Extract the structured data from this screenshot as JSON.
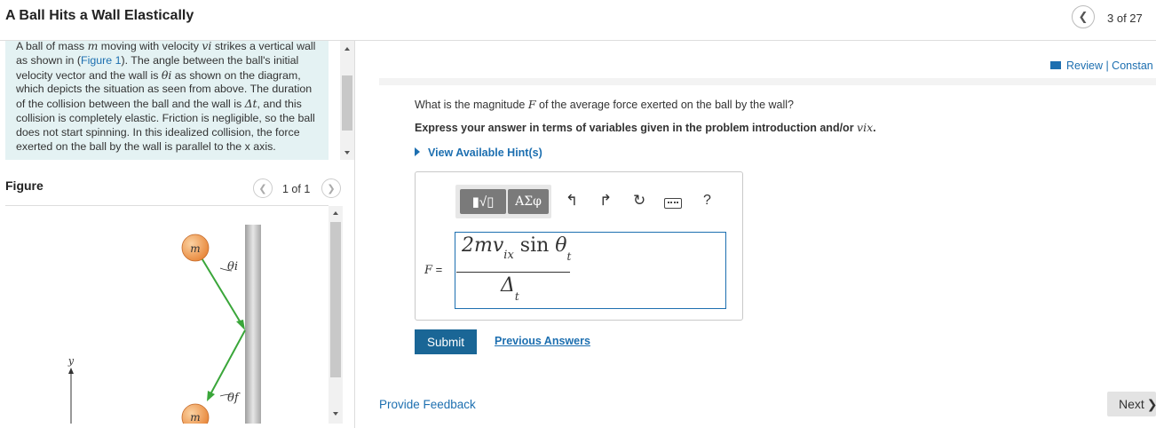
{
  "header": {
    "title": "A Ball Hits a Wall Elastically",
    "prev_icon": "chevron-left-icon",
    "counter": "3 of 27"
  },
  "intro": {
    "t1": "A ball of mass ",
    "v_m": "m",
    "t2": " moving with velocity ",
    "v_vi": "vi",
    "t3": " strikes a vertical wall as shown in (",
    "figure_link": "Figure 1",
    "t4": "). The angle between the ball's initial velocity vector and the wall is ",
    "v_thetai": "θi",
    "t5": " as shown on the diagram, which depicts the situation as seen from above. The duration of the collision between the ball and the wall is ",
    "v_dt": "Δt",
    "t6": ", and this collision is completely elastic. Friction is negligible, so the ball does not start spinning. In this idealized collision, the force exerted on the ball by the wall is parallel to the x axis."
  },
  "figure": {
    "label": "Figure",
    "counter": "1 of 1",
    "ball_top_label": "m",
    "ball_bottom_label": "m",
    "angle_top": "θi",
    "angle_bottom": "θf",
    "axis_y": "y",
    "colors": {
      "ball": "#e8873a",
      "vector": "#3aa63a",
      "wall": "#b4b4b4"
    }
  },
  "right": {
    "review": "Review | Constan",
    "question_pre": "What is the magnitude ",
    "question_var": "F",
    "question_post": " of the average force exerted on the ball by the wall?",
    "instruction_pre": "Express your answer in terms of variables given in the problem introduction and/or ",
    "instruction_var": "vix",
    "instruction_post": ".",
    "hint": "View Available Hint(s)"
  },
  "toolbar": {
    "templates": "▮√▯",
    "greek": "ΑΣφ",
    "undo": "↰",
    "redo": "↱",
    "reset": "↻",
    "keyboard_icon": "keyboard-icon",
    "help": "?"
  },
  "answer": {
    "f_label_var": "F",
    "f_label_eq": " =",
    "numerator": {
      "coef": "2mv",
      "sub": "ix",
      "fn": " sin ",
      "theta": "θ",
      "theta_sub": "t"
    },
    "denominator": {
      "delta": "Δ",
      "sub": "t"
    }
  },
  "actions": {
    "submit": "Submit",
    "previous_answers": "Previous Answers",
    "feedback": "Provide Feedback",
    "next": "Next",
    "next_icon": "❯"
  }
}
